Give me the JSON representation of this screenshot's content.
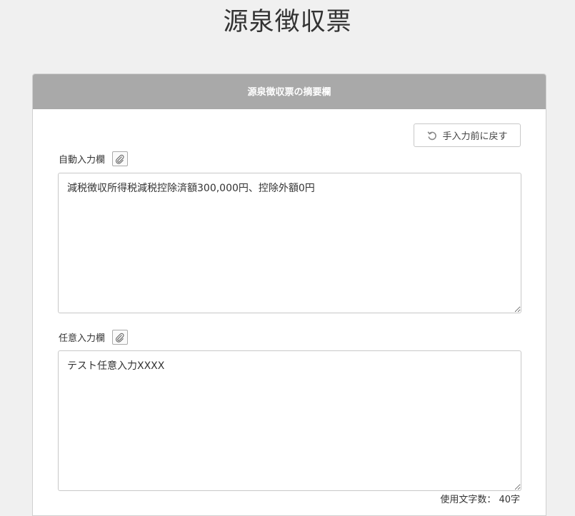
{
  "page": {
    "title": "源泉徴収票"
  },
  "panel": {
    "header": "源泉徴収票の摘要欄",
    "revert_button": "手入力前に戻す",
    "auto_field": {
      "label": "自動入力欄",
      "value": "減税徴収所得税減税控除済額300,000円、控除外額0円"
    },
    "optional_field": {
      "label": "任意入力欄",
      "value": "テスト任意入力XXXX"
    },
    "char_count": "使用文字数： 40字"
  }
}
